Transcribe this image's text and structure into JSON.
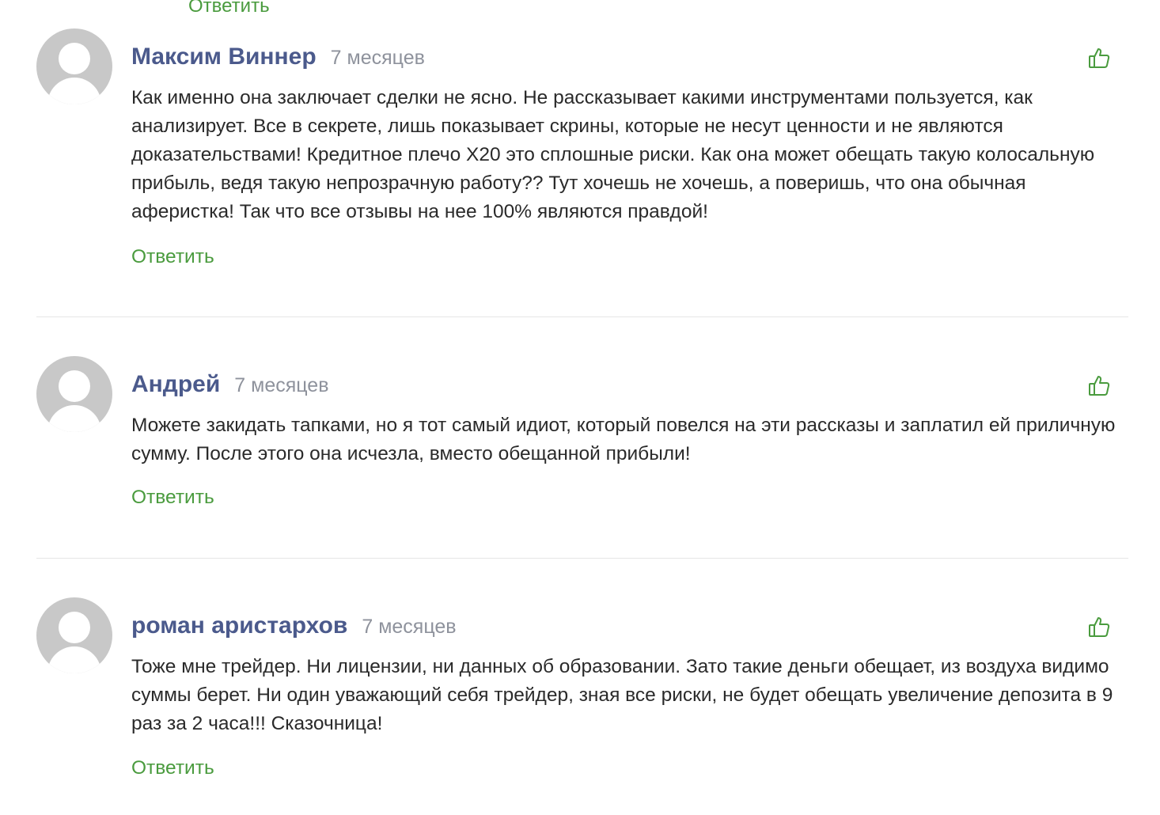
{
  "top_reply": "Ответить",
  "comments": [
    {
      "author": "Максим Виннер",
      "time": "7 месяцев",
      "text": "Как именно она заключает сделки не ясно. Не рассказывает какими инструментами пользуется, как анализирует. Все в секрете, лишь показывает скрины, которые не несут ценности и не являются доказательствами! Кредитное плечо Х20 это сплошные риски. Как она может обещать такую колосальную прибыль, ведя такую непрозрачную работу?? Тут хочешь не хочешь, а поверишь, что она обычная аферистка! Так что все отзывы на нее 100% являются правдой!",
      "reply": "Ответить",
      "like_icon": "thumbs-up-icon"
    },
    {
      "author": "Андрей",
      "time": "7 месяцев",
      "text": "Можете закидать тапками, но я тот самый идиот, который повелся на эти рассказы и заплатил ей приличную сумму. После этого она исчезла, вместо обещанной прибыли!",
      "reply": "Ответить",
      "like_icon": "thumbs-up-icon"
    },
    {
      "author": "роман аристархов",
      "time": "7 месяцев",
      "text": "Тоже мне трейдер. Ни лицензии, ни данных об образовании. Зато такие деньги обещает, из воздуха видимо суммы берет. Ни один уважающий себя трейдер, зная все риски, не будет обещать увеличение депозита в 9 раз за 2 часа!!! Сказочница!",
      "reply": "Ответить",
      "like_icon": "thumbs-up-icon"
    }
  ],
  "colors": {
    "author": "#4b5a8c",
    "time": "#8e929c",
    "reply": "#4a9b3e",
    "like": "#4a9b3e",
    "avatar": "#c8c8c8",
    "divider": "#e6e6e6"
  }
}
